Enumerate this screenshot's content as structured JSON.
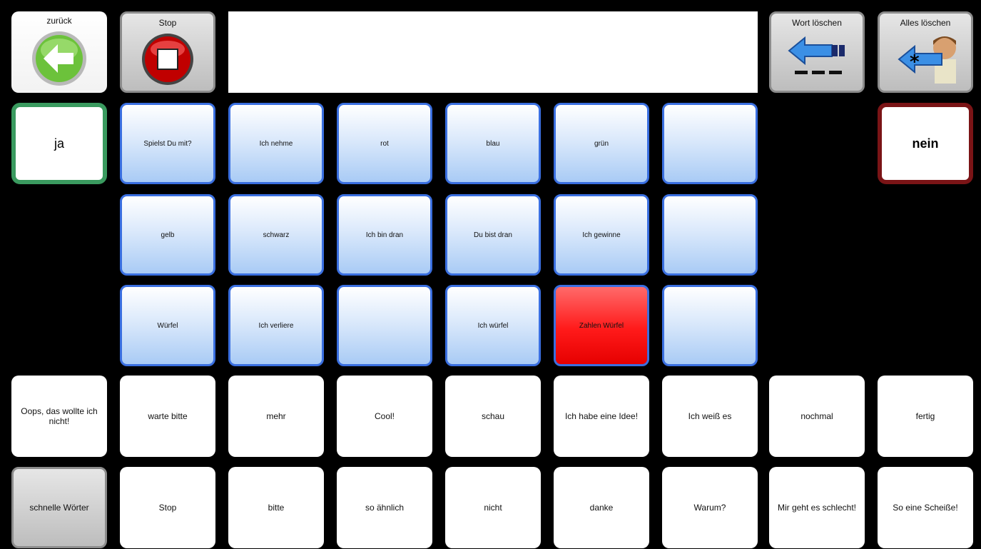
{
  "top_bar": {
    "back_label": "zurück",
    "stop_label": "Stop",
    "display_text": "",
    "delete_word_label": "Wort löschen",
    "delete_all_label": "Alles löschen"
  },
  "answers": {
    "yes": "ja",
    "no": "nein"
  },
  "vocab": [
    [
      "Spielst Du mit?",
      "Ich nehme",
      "rot",
      "blau",
      "grün",
      ""
    ],
    [
      "gelb",
      "schwarz",
      "Ich bin dran",
      "Du bist dran",
      "Ich gewinne",
      ""
    ],
    [
      "Würfel",
      "Ich verliere",
      "",
      "Ich würfel",
      "Zahlen Würfel",
      ""
    ]
  ],
  "quick_words": {
    "row1": [
      "Oops, das wollte ich nicht!",
      "warte bitte",
      "mehr",
      "Cool!",
      "schau",
      "Ich habe eine Idee!",
      "Ich weiß es",
      "nochmal",
      "fertig"
    ],
    "row2": [
      "schnelle Wörter",
      "Stop",
      "bitte",
      "so ähnlich",
      "nicht",
      "danke",
      "Warum?",
      "Mir geht es schlecht!",
      "So eine Scheiße!"
    ]
  },
  "colors": {
    "accent_blue": "#3a6fe0",
    "yes_border": "#3a9a5f",
    "no_border": "#7a1416",
    "highlight_red": "#ff1a1a"
  },
  "icons": {
    "back": "back-arrow-icon",
    "stop": "stop-icon",
    "delete_word": "delete-word-arrow-icon",
    "delete_all": "delete-all-arrow-icon"
  }
}
